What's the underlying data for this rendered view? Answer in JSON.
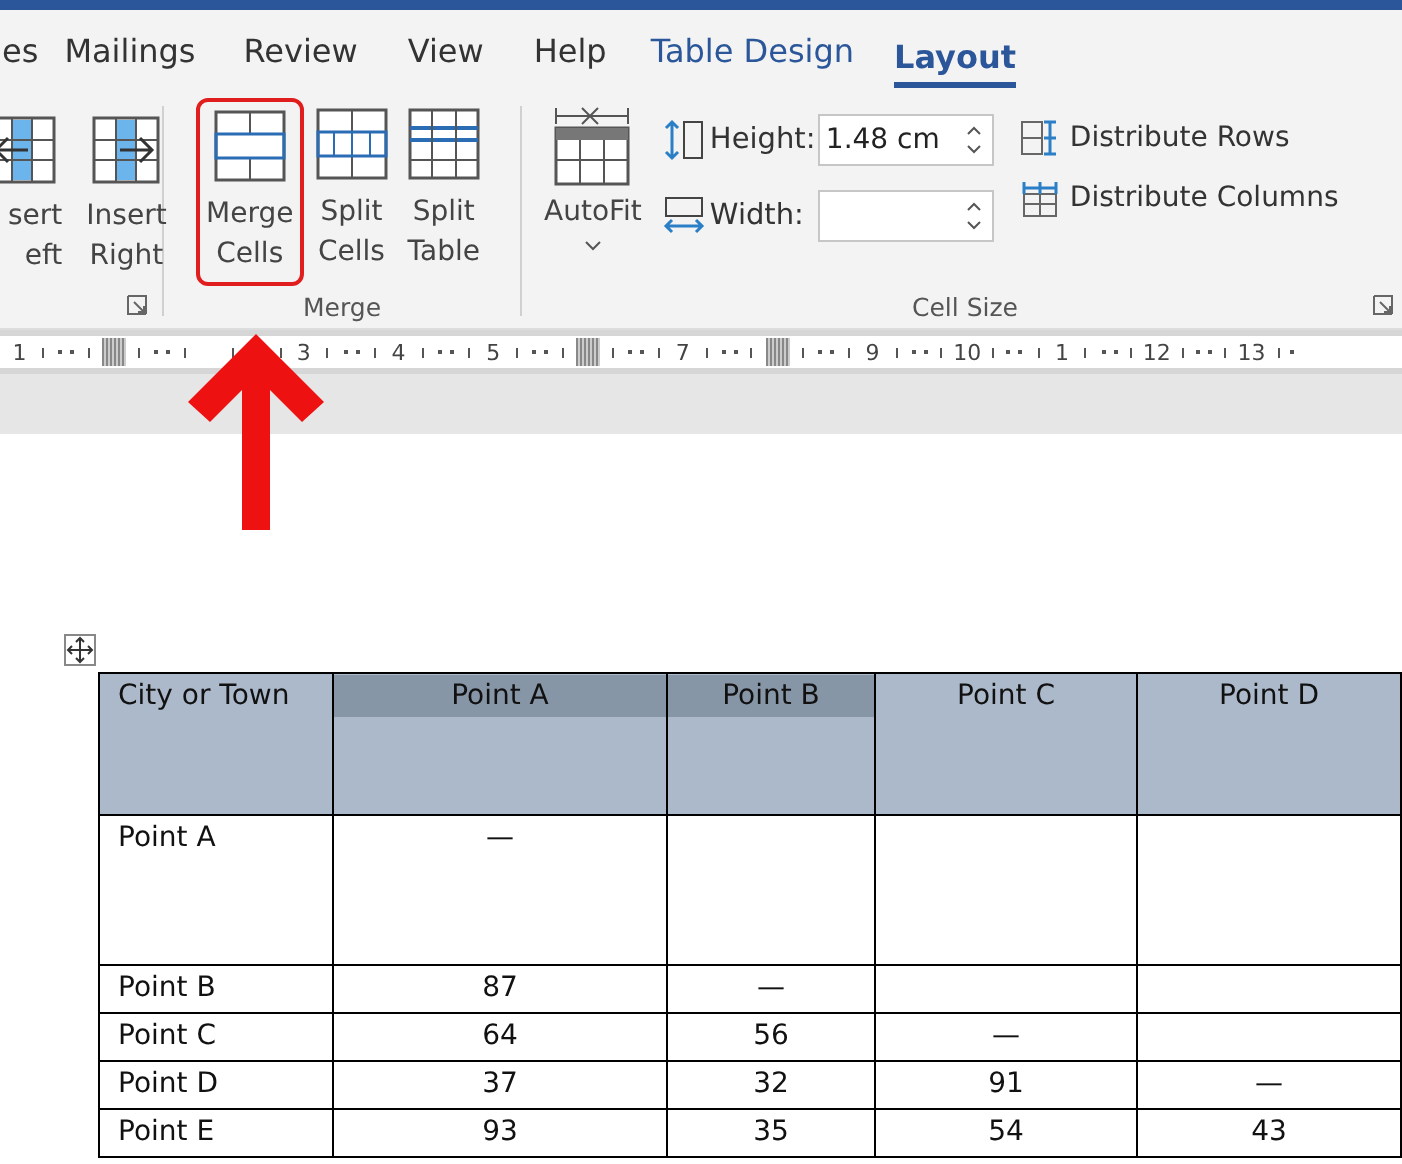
{
  "tabs": [
    {
      "label": "es",
      "selected": false,
      "kind": "plain"
    },
    {
      "label": "Mailings",
      "selected": false,
      "kind": "plain"
    },
    {
      "label": "Review",
      "selected": false,
      "kind": "plain"
    },
    {
      "label": "View",
      "selected": false,
      "kind": "plain"
    },
    {
      "label": "Help",
      "selected": false,
      "kind": "plain"
    },
    {
      "label": "Table Design",
      "selected": false,
      "kind": "contextual"
    },
    {
      "label": "Layout",
      "selected": true,
      "kind": "contextual"
    }
  ],
  "ribbon": {
    "rows_columns_group": {
      "buttons": [
        {
          "lines": [
            "sert",
            "eft"
          ],
          "kind": "insert-left"
        },
        {
          "lines": [
            "Insert",
            "Right"
          ],
          "kind": "insert-right"
        }
      ]
    },
    "merge_group": {
      "label": "Merge",
      "buttons": [
        {
          "lines": [
            "Merge",
            "Cells"
          ],
          "kind": "merge",
          "highlighted": true
        },
        {
          "lines": [
            "Split",
            "Cells"
          ],
          "kind": "split-cells",
          "highlighted": false
        },
        {
          "lines": [
            "Split",
            "Table"
          ],
          "kind": "split-table",
          "highlighted": false
        }
      ]
    },
    "cell_size_group": {
      "label": "Cell Size",
      "autofit": {
        "label": "AutoFit"
      },
      "height": {
        "label": "Height:",
        "value": "1.48 cm"
      },
      "width": {
        "label": "Width:"
      },
      "distribute_rows": "Distribute Rows",
      "distribute_columns": "Distribute Columns"
    }
  },
  "ruler": [
    {
      "kind": "number",
      "label": "1"
    },
    {
      "kind": "marker"
    },
    {
      "kind": "hidden"
    },
    {
      "kind": "number",
      "label": "3"
    },
    {
      "kind": "number",
      "label": "4"
    },
    {
      "kind": "number",
      "label": "5"
    },
    {
      "kind": "marker"
    },
    {
      "kind": "number",
      "label": "7"
    },
    {
      "kind": "marker"
    },
    {
      "kind": "number",
      "label": "9"
    },
    {
      "kind": "number",
      "label": "10"
    },
    {
      "kind": "number",
      "label": "1"
    },
    {
      "kind": "number",
      "label": "12"
    },
    {
      "kind": "number",
      "label": "13"
    }
  ],
  "table": {
    "columns": [
      {
        "label": "City or Town",
        "selected": false
      },
      {
        "label": "Point A",
        "selected": true
      },
      {
        "label": "Point B",
        "selected": true
      },
      {
        "label": "Point C",
        "selected": false
      },
      {
        "label": "Point D",
        "selected": false
      }
    ],
    "rows": [
      {
        "tall": true,
        "cells": [
          "Point A",
          "—",
          "",
          "",
          ""
        ]
      },
      {
        "tall": false,
        "cells": [
          "Point B",
          "87",
          "—",
          "",
          ""
        ]
      },
      {
        "tall": false,
        "cells": [
          "Point C",
          "64",
          "56",
          "—",
          ""
        ]
      },
      {
        "tall": false,
        "cells": [
          "Point D",
          "37",
          "32",
          "91",
          "—"
        ]
      },
      {
        "tall": false,
        "cells": [
          "Point E",
          "93",
          "35",
          "54",
          "43"
        ]
      }
    ]
  },
  "annotation": {
    "arrow": true
  }
}
